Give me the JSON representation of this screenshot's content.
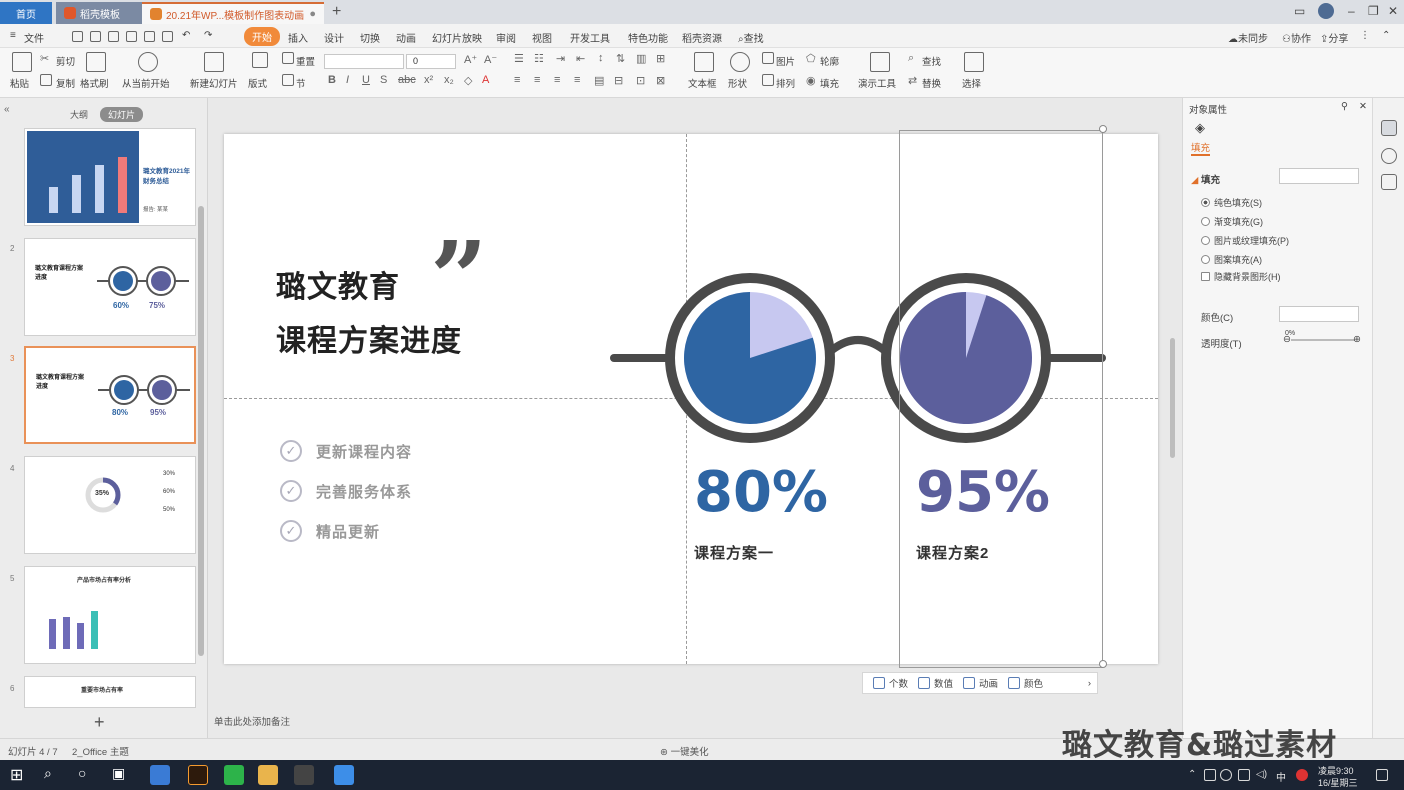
{
  "tabs": {
    "home": "首页",
    "templates": "稻壳模板",
    "document": "20.21年WP...模板制作图表动画"
  },
  "menu": {
    "file": "文件",
    "items": [
      "开始",
      "插入",
      "设计",
      "切换",
      "动画",
      "幻灯片放映",
      "审阅",
      "视图",
      "开发工具",
      "特色功能",
      "稻壳资源"
    ],
    "search": "查找",
    "sync": "未同步",
    "collab": "协作",
    "share": "分享"
  },
  "ribbon": {
    "paste": "粘贴",
    "cut": "剪切",
    "copy": "复制",
    "format_painter": "格式刷",
    "from_current": "从当前开始",
    "new_slide": "新建幻灯片",
    "layout": "版式",
    "section": "节",
    "reset": "重置",
    "font_size": "0",
    "textbox": "文本框",
    "shape": "形状",
    "arrange": "排列",
    "picture": "图片",
    "outline": "轮廓",
    "fill": "填充",
    "present_tool": "演示工具",
    "find": "查找",
    "replace": "替换",
    "select": "选择"
  },
  "left_pane": {
    "tab_outline": "大纲",
    "tab_slides": "幻灯片",
    "slide_numbers": [
      "",
      "2",
      "3",
      "4",
      "5",
      "6"
    ],
    "thumb1": {
      "title": "璐文教育2021年财务总结",
      "footer": "报告: 某某"
    },
    "thumb2": {
      "title": "璐文教育课程方案进度",
      "p1": "60%",
      "p2": "75%"
    },
    "thumb3": {
      "title": "璐文教育课程方案进度",
      "p1": "80%",
      "p2": "95%"
    },
    "thumb4": {
      "center": "35%",
      "a": "30%",
      "b": "60%",
      "c": "50%"
    },
    "thumb5": {
      "title": "产品市场占有率分析"
    },
    "thumb6": {
      "title": "重要市场占有率"
    }
  },
  "slide": {
    "title_line1": "璐文教育",
    "title_line2": "课程方案进度",
    "quote": "”",
    "checklist": [
      "更新课程内容",
      "完善服务体系",
      "精品更新"
    ],
    "check_glyph": "✓",
    "plan1": {
      "label": "课程方案一",
      "value": 80,
      "display": "80%",
      "color": "#2e65a3",
      "slice_color": "#c7c8f0"
    },
    "plan2": {
      "label": "课程方案2",
      "value": 95,
      "display": "95%",
      "color": "#5c5f9c",
      "slice_color": "#c7c8f0"
    }
  },
  "canvas_toolbar": {
    "count": "个数",
    "value": "数值",
    "animation": "动画",
    "color": "颜色"
  },
  "notes_placeholder": "单击此处添加备注",
  "right_pane": {
    "title": "对象属性",
    "tab_fill": "填充",
    "section_fill": "填充",
    "options": [
      "纯色填充(S)",
      "渐变填充(G)",
      "图片或纹理填充(P)",
      "图案填充(A)"
    ],
    "hide_bg": "隐藏背景图形(H)",
    "color_label": "颜色(C)",
    "transparency_label": "透明度(T)",
    "transparency_value": "0%"
  },
  "status": {
    "slide_info": "幻灯片 4 / 7",
    "theme": "2_Office 主题",
    "beautify": "一键美化"
  },
  "watermark": "璐文教育&璐过素材",
  "taskbar": {
    "ime": "中",
    "time": "凌晨9:30",
    "date": "16/星期三"
  },
  "icons": {
    "home": "home-icon",
    "search": "search-icon",
    "close": "close-icon",
    "check": "check-circle-icon",
    "pin": "pin-icon",
    "plus": "plus-icon"
  },
  "colors": {
    "accent": "#f18a3a",
    "plan1": "#2e65a3",
    "plan2": "#5c5f9c"
  }
}
